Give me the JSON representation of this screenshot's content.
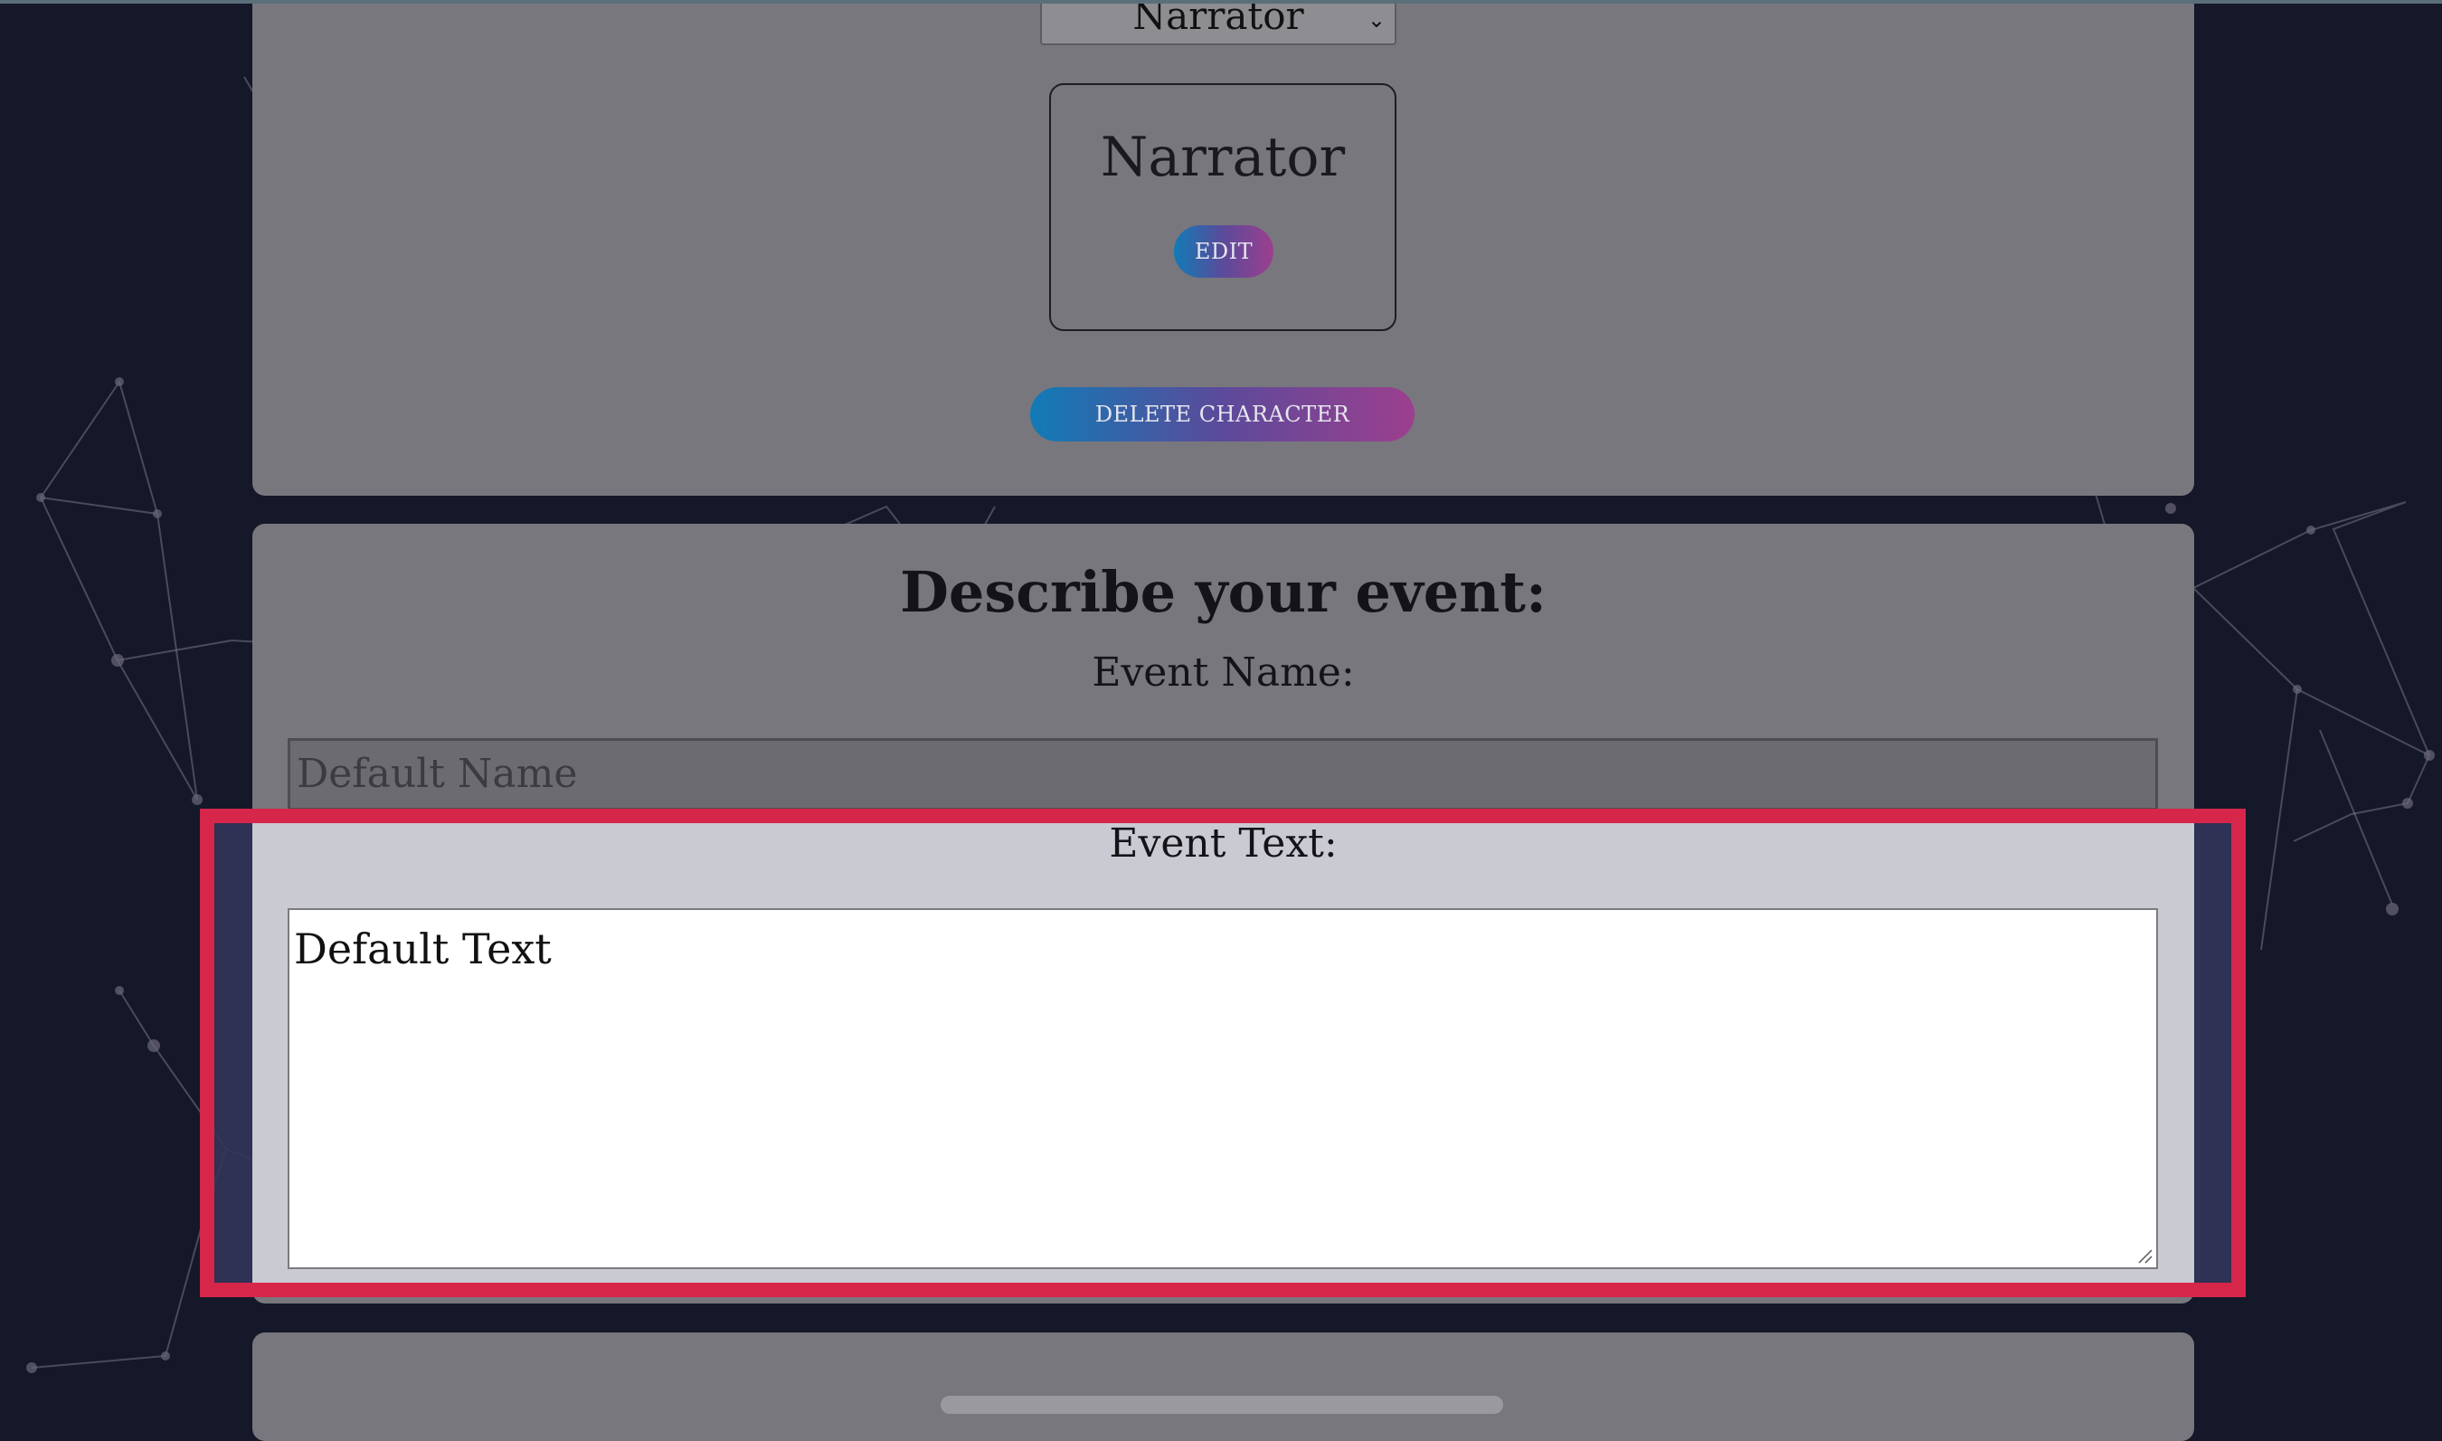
{
  "character_select": {
    "value": "Narrator",
    "chevron": "chevron-down-icon"
  },
  "character_card": {
    "name": "Narrator",
    "edit_label": "EDIT"
  },
  "delete_character_label": "DELETE CHARACTER",
  "event": {
    "heading": "Describe your event:",
    "name_label": "Event Name:",
    "name_value": "Default Name",
    "text_label": "Event Text:",
    "text_value": "Default Text"
  },
  "colors": {
    "background": "#141829",
    "panel": "#78777d",
    "highlight_frame": "#d6264a",
    "button_gradient_start": "#117bb6",
    "button_gradient_end": "#9c3f8e"
  }
}
